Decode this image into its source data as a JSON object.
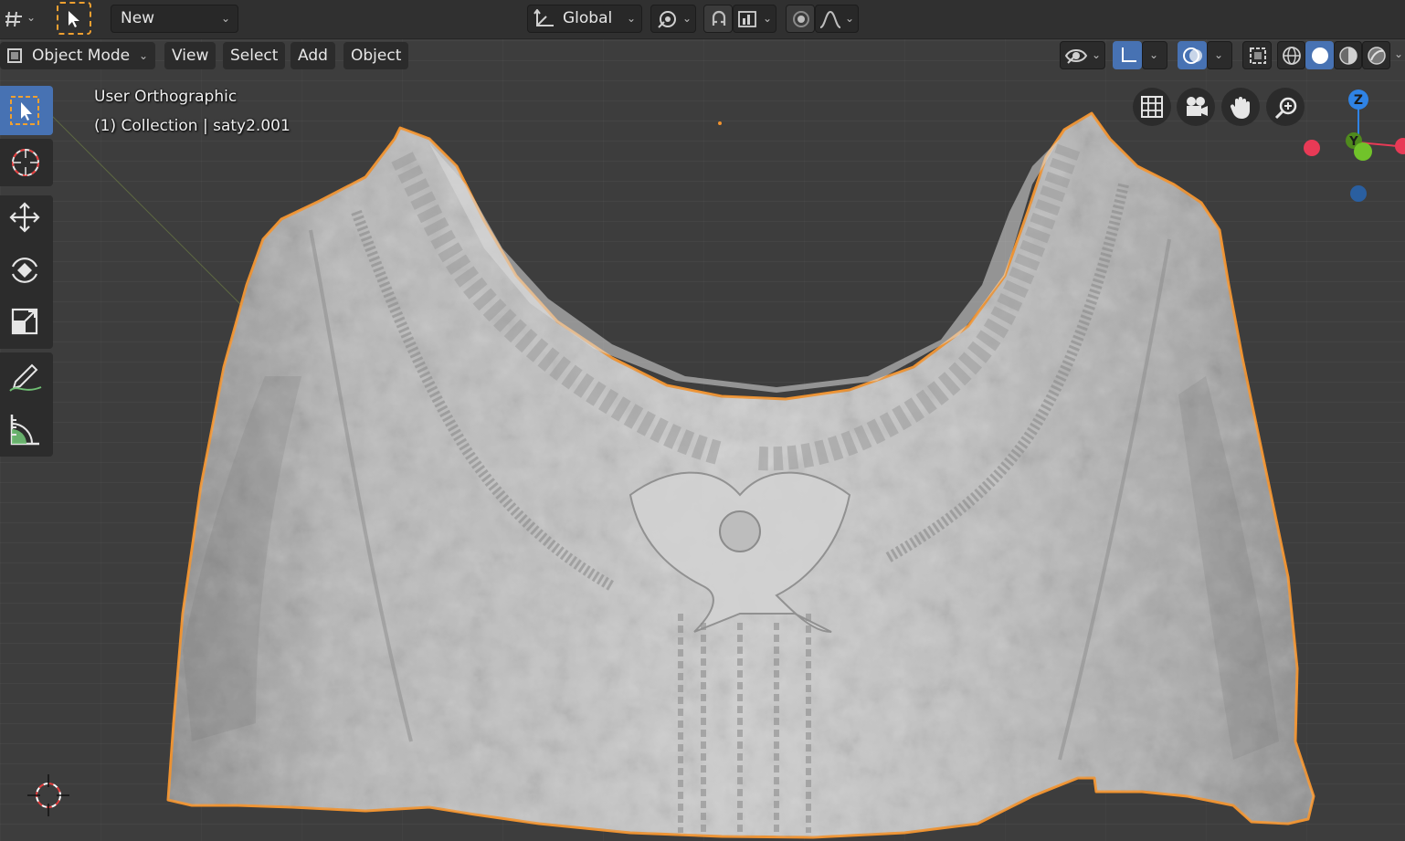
{
  "header": {
    "editor_type_icon": "viewport-editor-icon",
    "select_tool_icon": "select-box-icon",
    "action_label": "New",
    "orientation_label": "Global",
    "pivot_icon": "pivot-icon",
    "snap_icon": "snap-magnet-icon",
    "snap_target_icon": "snap-increment-icon",
    "proportional_icon": "proportional-edit-icon",
    "falloff_icon": "falloff-curve-icon"
  },
  "menubar": {
    "mode_label": "Object Mode",
    "menus": [
      "View",
      "Select",
      "Add",
      "Object"
    ],
    "visibility_icon": "eye-icon",
    "gizmo_icon": "gizmo-axes-icon",
    "overlay_icon": "overlays-icon",
    "xray_icon": "xray-icon",
    "shading_icons": [
      "wireframe-shading-icon",
      "solid-shading-icon",
      "material-shading-icon",
      "rendered-shading-icon"
    ]
  },
  "toolbar": {
    "tools": [
      "select-box-icon",
      "cursor-icon",
      "move-icon",
      "rotate-icon",
      "scale-icon",
      "annotate-icon",
      "measure-icon"
    ]
  },
  "viewport": {
    "view_name": "User Orthographic",
    "collection_info": "(1) Collection | saty2.001",
    "object_name": "saty2.001",
    "selection_color": "#f0922e",
    "mesh_color": "#b9b9b9"
  },
  "navigation": {
    "buttons": [
      "grid-toggle-icon",
      "camera-icon",
      "hand-pan-icon",
      "zoom-icon"
    ]
  },
  "gizmo": {
    "z_label": "Z",
    "y_label": "Y",
    "x_color": "#e83a56",
    "y_color": "#71c32a",
    "z_color": "#2f83e5"
  }
}
